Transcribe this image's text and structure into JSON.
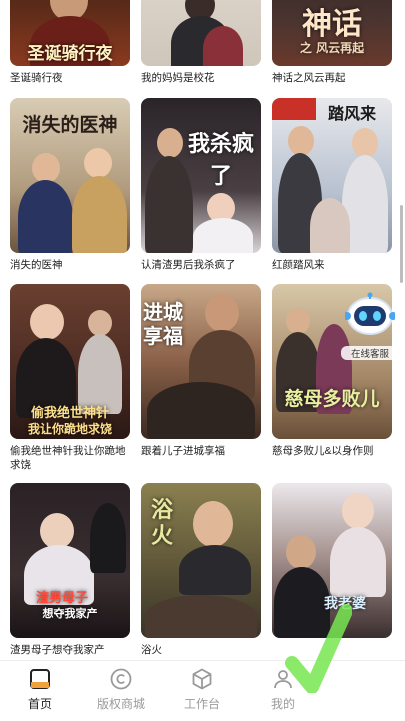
{
  "dramas": [
    {
      "title": "圣诞骑行夜",
      "overlay": "圣诞骑行夜",
      "bg": "#4a2418"
    },
    {
      "title": "我的妈妈是校花",
      "overlay": "",
      "bg": "#d9d2c8"
    },
    {
      "title": "神话之风云再起",
      "overlay": "神话",
      "bg": "#3a2c2a"
    },
    {
      "title": "消失的医神",
      "overlay": "消失的医神",
      "bg": "#b5a48a"
    },
    {
      "title": "认清渣男后我杀疯了",
      "overlay": "我杀疯了",
      "bg": "#3a3438"
    },
    {
      "title": "红颜踏风来",
      "overlay": "踏风来",
      "bg": "#c4ccd8"
    },
    {
      "title": "偷我绝世神针我让你跪地求饶",
      "overlay": "偷我绝世神针",
      "bg": "#5a3a30"
    },
    {
      "title": "跟着儿子进城享福",
      "overlay": "进城享福",
      "bg": "#8a6048"
    },
    {
      "title": "慈母多败儿&以身作则",
      "overlay": "慈母多败儿",
      "bg": "#b09878"
    },
    {
      "title": "渣男母子想夺我家产",
      "overlay": "渣男母子",
      "bg": "#2a2226"
    },
    {
      "title": "浴火",
      "overlay": "浴火",
      "bg": "#6a6040"
    },
    {
      "title": "",
      "overlay": "我老婆",
      "bg": "#5a4a48"
    }
  ],
  "service": {
    "label": "在线客服"
  },
  "tabs": [
    {
      "label": "首页",
      "icon": "home-icon",
      "active": true
    },
    {
      "label": "版权商城",
      "icon": "copyright-icon",
      "active": false
    },
    {
      "label": "工作台",
      "icon": "cube-icon",
      "active": false
    },
    {
      "label": "我的",
      "icon": "user-icon",
      "active": false
    }
  ],
  "colors": {
    "accent": "#f2a23a",
    "inactive": "#9a9a9a"
  }
}
